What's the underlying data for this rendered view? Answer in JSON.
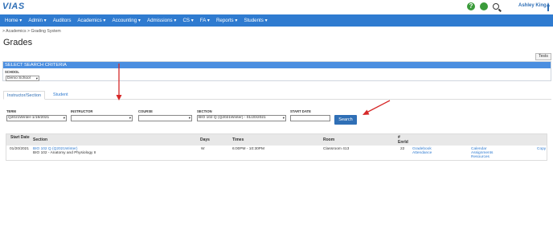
{
  "header": {
    "logo": "VIAS",
    "username": "Ashley King",
    "icons": [
      "help-icon",
      "globe-icon",
      "search-icon",
      "user-icon"
    ]
  },
  "nav": {
    "items": [
      "Home",
      "Admin",
      "Auditors",
      "Academics",
      "Accounting",
      "Admissions",
      "CS",
      "FA",
      "Reports",
      "Students"
    ]
  },
  "breadcrumb": "> Academics > Grading System",
  "page_title": "Grades",
  "tests_button": "Tests",
  "criteria": {
    "header": "SELECT SEARCH CRITERIA",
    "school_label": "SCHOOL",
    "school_value": "Demo School"
  },
  "tabs": {
    "instructor_section": "Instructor/Section",
    "student": "Student"
  },
  "filters": {
    "term_label": "TERM",
    "term_value": "Q2021Winter-1/19/2021",
    "instructor_label": "INSTRUCTOR",
    "instructor_value": "",
    "course_label": "COURSE",
    "course_value": "",
    "section_label": "SECTION",
    "section_value": "BIO 102 Q (Q2021Winter) - 01/20/2021",
    "start_date_label": "START DATE",
    "start_date_value": "",
    "search_button": "Search"
  },
  "results": {
    "columns": [
      "Start Date",
      "Section",
      "Days",
      "Times",
      "Room",
      "# Enrld"
    ],
    "rows": [
      {
        "start_date": "01/20/2021",
        "section_link": "BIO 102 Q (Q2021Winter)",
        "section_name": "BIO 102 - Anatomy and Physiology II",
        "days": "W",
        "times": "6:00PM - 10:30PM",
        "room": "Classroom 413",
        "enrolled": "22",
        "link_gradebook": "Gradebook",
        "link_attendance": "Attendance",
        "link_calendar": "Calendar",
        "link_assignments": "Assignments",
        "link_resources": "Resources",
        "link_copy": "Copy"
      }
    ]
  },
  "colors": {
    "nav_bg": "#2f7bd0",
    "accent": "#2f6fb6",
    "criteria_header_bg": "#4a8ee0",
    "annotation_arrow": "#d62828"
  }
}
